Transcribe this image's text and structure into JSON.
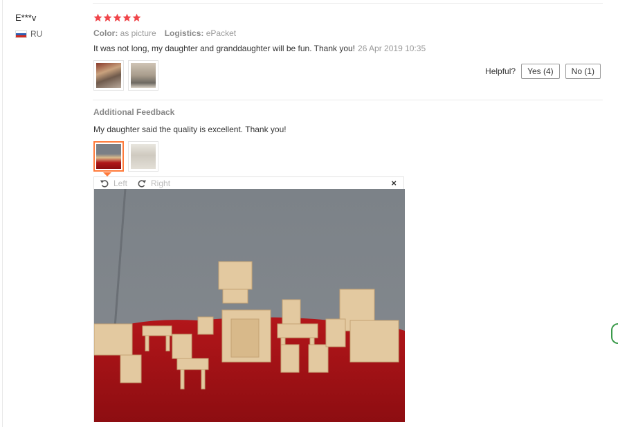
{
  "review": {
    "user": "E***v",
    "country_code": "RU",
    "rating": 5,
    "color_label": "Color:",
    "color_value": "as picture",
    "logistics_label": "Logistics:",
    "logistics_value": "ePacket",
    "text": "It was not long, my daughter and granddaughter will be fun. Thank you!",
    "date": "26 Apr 2019 10:35"
  },
  "helpful": {
    "label": "Helpful?",
    "yes": "Yes (4)",
    "no": "No (1)"
  },
  "additional": {
    "title": "Additional Feedback",
    "text": "My daughter said the quality is excellent. Thank you!"
  },
  "viewer": {
    "rotate_left": "Left",
    "rotate_right": "Right",
    "close": "×"
  },
  "colors": {
    "star": "#f0454a",
    "accent": "#ff7a3a",
    "flag_white": "#ffffff",
    "flag_blue": "#2f5fb3",
    "flag_red": "#d52b1e"
  }
}
